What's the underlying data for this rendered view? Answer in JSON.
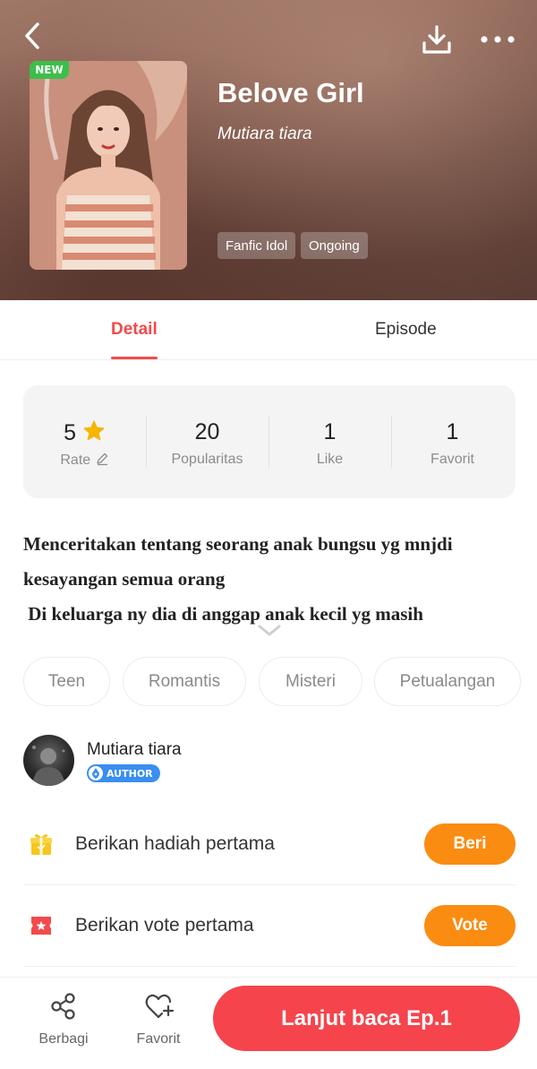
{
  "header": {
    "badge": "NEW",
    "title": "Belove Girl",
    "author": "Mutiara tiara",
    "tags": [
      "Fanfic Idol",
      "Ongoing"
    ]
  },
  "tabs": [
    {
      "label": "Detail",
      "active": true
    },
    {
      "label": "Episode",
      "active": false
    }
  ],
  "stats": {
    "rate": {
      "value": "5",
      "label": "Rate"
    },
    "popularity": {
      "value": "20",
      "label": "Popularitas"
    },
    "like": {
      "value": "1",
      "label": "Like"
    },
    "favorite": {
      "value": "1",
      "label": "Favorit"
    }
  },
  "synopsis": {
    "lines": [
      "Menceritakan tentang seorang anak bungsu yg mnjdi",
      "kesayangan semua orang",
      " Di keluarga ny dia di anggap anak kecil yg masih"
    ]
  },
  "genres": [
    "Teen",
    "Romantis",
    "Misteri",
    "Petualangan"
  ],
  "author_section": {
    "name": "Mutiara tiara",
    "badge": "AUTHOR"
  },
  "actions": [
    {
      "label": "Berikan hadiah pertama",
      "button": "Beri",
      "icon": "gift-icon"
    },
    {
      "label": "Berikan vote pertama",
      "button": "Vote",
      "icon": "vote-ticket-icon"
    }
  ],
  "bottom_bar": {
    "share_label": "Berbagi",
    "favorite_label": "Favorit",
    "read_button": "Lanjut baca Ep.1"
  },
  "colors": {
    "accent": "#f24a4a",
    "action_button": "#fa8c12",
    "read_button": "#f5444c",
    "new_badge": "#3cbf4a",
    "star": "#f7b500",
    "author_badge": "#3a8ef0"
  }
}
